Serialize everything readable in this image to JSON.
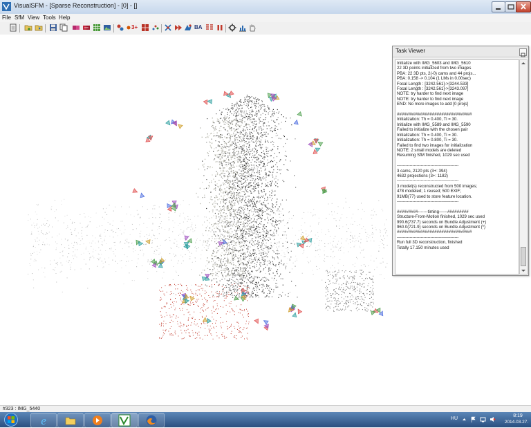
{
  "window": {
    "title": "VisualSFM - [Sparse Reconstruction] - [0] - []",
    "controls": {
      "minimize": "minimize",
      "maximize": "maximize",
      "close": "close"
    }
  },
  "menu": {
    "items": [
      "File",
      "SfM",
      "View",
      "Tools",
      "Help"
    ]
  },
  "toolbar": {
    "icons": [
      "log-icon",
      "open-add-icon",
      "open-multi-icon",
      "save-icon",
      "copy-icon",
      "pairwise-icon",
      "match-icon",
      "grid-icon",
      "image-icon",
      "sfm-icon",
      "compute-3plus-icon",
      "grid-3plus-icon",
      "points-icon",
      "xfm-icon",
      "forward-icon",
      "cmvs-icon",
      "ba-text",
      "matrix-icon",
      "pause-icon",
      "gear-icon",
      "chart-icon",
      "hand-icon"
    ],
    "text_labels": {
      "three_plus": "3+",
      "ba": "BA"
    }
  },
  "task_viewer": {
    "title": "Task Viewer",
    "log": "Initialize with IMG_5603 and IMG_5610\n22 3D points initialized from two images\nPBA: 22 3D pts, 2(-0) cams and 44 projs...\nPBA: 0.158 -> 0.104 (1 LMs in 0.00sec)\nFocal Length : [3242.561]->[3244.533]\nFocal Length : [3242.561]->[3243.097]\nNOTE: try harder to find next image\nNOTE: try harder to find next image\nEND: No more images to add [0 projs]\n\n################################\nInitialization: Th = 0.400, Ti = 30.\nInitialize with IMG_5589 and IMG_5590\nFailed to initialize with the chosen pair\nInitialization: Th = 0.400, Ti = 30.\nInitialization: Th = 0.800, Ti = 30.\nFailed to find two images for initialization\nNOTE: 2 small models are deleted\nResuming SfM finished, 1029 sec used\n\n--------------------------------------------\n3 cams, 2120 pts (3+: 394)\n4632 projections (3+: 1182)\n--------------------------------------------\n3 model(s) reconstructed from 500 images;\n478 modeled; 1 reused; 500 EXIF;\n91MB(77) used to store feature location.\n--------------------------------------------\n\n#########-------timing------#########\nStructure-From-Motion finished, 1029 sec used\n990.6(737.7) seconds on Bundle Adjustment (+)\n960.0(721.9) seconds on Bundle Adjustment (*)\n################################\n--------------------------------------------\nRun full 3D reconstruction, finished\nTotally 17.150 minutes used"
  },
  "status_bar": {
    "text": "#323 : IMG_5440"
  },
  "taskbar": {
    "apps": [
      "internet-explorer-icon",
      "file-explorer-icon",
      "media-player-icon",
      "visualsfm-icon",
      "firefox-icon"
    ],
    "language": "HU",
    "time": "8:19",
    "date": "2014.03.27."
  },
  "colors": {
    "accent": "#3a6ea5",
    "taskbar": "#2a4f80",
    "point_dark": "#3a3a3a",
    "point_red": "#c0392b",
    "camera_colors": [
      "#e05050",
      "#50a050",
      "#5070e0",
      "#d0a030",
      "#a050c0",
      "#30a0a0"
    ]
  }
}
